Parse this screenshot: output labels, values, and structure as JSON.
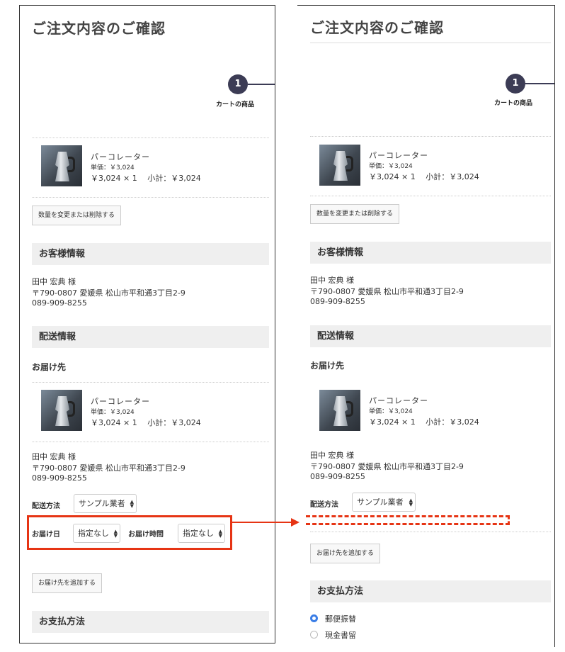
{
  "page_title": "ご注文内容のご確認",
  "step": {
    "number": "1",
    "label": "カートの商品"
  },
  "item": {
    "name": "パーコレーター",
    "unit_price": "単価：￥3,024",
    "price_line": "￥3,024 × 1　 小計：￥3,024"
  },
  "change_qty_button": "数量を変更または削除する",
  "customer": {
    "heading": "お客様情報",
    "name": "田中 宏典 様",
    "address": "〒790-0807 愛媛県 松山市平和通3丁目2-9",
    "phone": "089-909-8255"
  },
  "shipping": {
    "heading": "配送情報",
    "destination_label": "お届け先",
    "method_label": "配送方法",
    "method_value": "サンプル業者",
    "date_label": "お届け日",
    "date_value": "指定なし",
    "time_label": "お届け時間",
    "time_value": "指定なし",
    "add_destination_button": "お届け先を追加する"
  },
  "payment": {
    "heading": "お支払方法",
    "options": [
      "郵便振替",
      "現金書留"
    ],
    "selected": "郵便振替"
  },
  "colors": {
    "highlight": "#e63414",
    "step": "#3c3c55",
    "radio_selected": "#3b7ee6"
  }
}
